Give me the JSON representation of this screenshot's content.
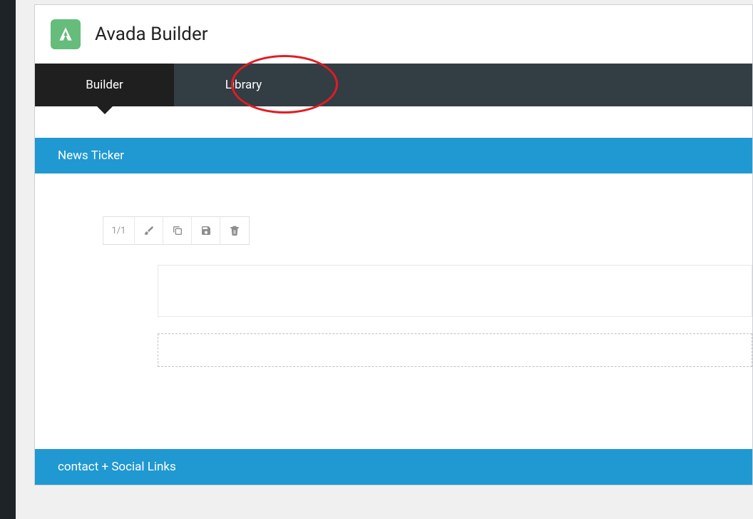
{
  "header": {
    "title": "Avada Builder"
  },
  "tabs": {
    "builder": "Builder",
    "library": "Library"
  },
  "sections": {
    "news_ticker": {
      "title": "News Ticker",
      "column_label": "1/1"
    },
    "contact_social": {
      "title": "contact + Social Links"
    }
  }
}
